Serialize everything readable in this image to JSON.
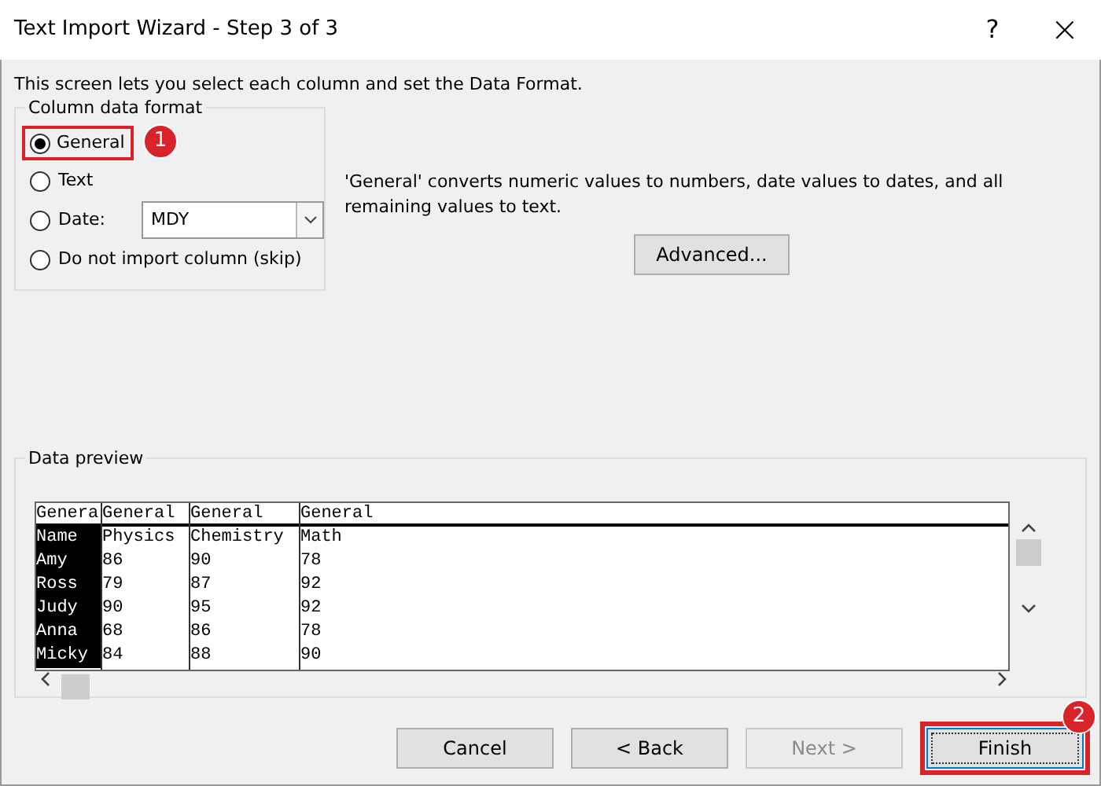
{
  "window": {
    "title": "Text Import Wizard - Step 3 of 3",
    "help": "?",
    "close": "×"
  },
  "intro": "This screen lets you select each column and set the Data Format.",
  "format_group": {
    "title": "Column data format",
    "options": [
      {
        "label": "General",
        "kind": "radio",
        "selected": true,
        "callout": "1"
      },
      {
        "label": "Text",
        "kind": "radio",
        "selected": false
      },
      {
        "label": "Date:",
        "kind": "date",
        "selected": false,
        "value": "MDY"
      },
      {
        "label": "Do not import column (skip)",
        "kind": "radio",
        "selected": false
      }
    ]
  },
  "explanation": "'General' converts numeric values to numbers, date values to dates, and all remaining values to text.",
  "advanced_button": "Advanced...",
  "preview": {
    "title": "Data preview",
    "columns": [
      {
        "header": "Genera",
        "selected": true,
        "cells": [
          "Name",
          "Amy",
          "Ross",
          "Judy",
          "Anna",
          "Micky"
        ]
      },
      {
        "header": "General",
        "selected": false,
        "cells": [
          "Physics",
          "86",
          "79",
          "90",
          "68",
          "84"
        ]
      },
      {
        "header": "General",
        "selected": false,
        "cells": [
          "Chemistry",
          "90",
          "87",
          "95",
          "86",
          "88"
        ]
      },
      {
        "header": "General",
        "selected": false,
        "cells": [
          "Math",
          "78",
          "92",
          "92",
          "78",
          "90"
        ]
      }
    ]
  },
  "buttons": [
    {
      "label": "Cancel",
      "disabled": false,
      "default": false
    },
    {
      "label": "< Back",
      "disabled": false,
      "default": false
    },
    {
      "label": "Next >",
      "disabled": true,
      "default": false
    },
    {
      "label": "Finish",
      "disabled": false,
      "default": true,
      "callout": "2"
    }
  ]
}
